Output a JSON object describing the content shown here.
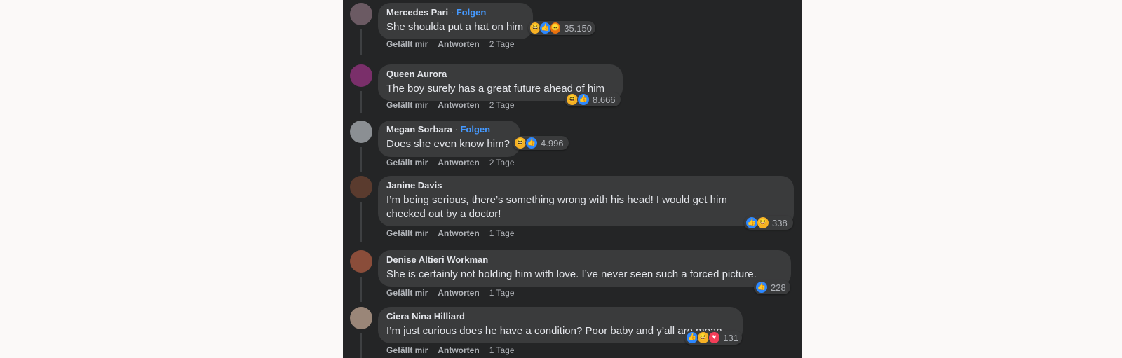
{
  "comments": [
    {
      "author": "Mercedes Pari",
      "follow": "Folgen",
      "text": "She shoulda put a hat on him",
      "like": "Gefällt mir",
      "reply": "Antworten",
      "time": "2 Tage",
      "reactions": [
        "haha",
        "like",
        "angry"
      ],
      "count": "35.150",
      "avatar_color": "#6b5a63"
    },
    {
      "author": "Queen Aurora",
      "follow": "",
      "text": "The boy surely has a great future ahead of him",
      "like": "Gefällt mir",
      "reply": "Antworten",
      "time": "2 Tage",
      "reactions": [
        "haha",
        "like"
      ],
      "count": "8.666",
      "avatar_color": "#7a2f6a"
    },
    {
      "author": "Megan Sorbara",
      "follow": "Folgen",
      "text": "Does she even know him?",
      "like": "Gefällt mir",
      "reply": "Antworten",
      "time": "2 Tage",
      "reactions": [
        "haha",
        "like"
      ],
      "count": "4.996",
      "avatar_color": "#8b8f93"
    },
    {
      "author": "Janine Davis",
      "follow": "",
      "text": "I’m being serious, there’s something wrong with his head! I would get him checked out by a doctor!",
      "like": "Gefällt mir",
      "reply": "Antworten",
      "time": "1 Tage",
      "reactions": [
        "like",
        "haha"
      ],
      "count": "338",
      "avatar_color": "#5a3b2e"
    },
    {
      "author": "Denise Altieri Workman",
      "follow": "",
      "text": "She is certainly not holding him with love. I’ve never seen such a forced picture.",
      "like": "Gefällt mir",
      "reply": "Antworten",
      "time": "1 Tage",
      "reactions": [
        "like"
      ],
      "count": "228",
      "avatar_color": "#8a4d3a"
    },
    {
      "author": "Ciera Nina Hilliard",
      "follow": "",
      "text": "I’m just curious does he have a condition? Poor baby and y’all are mean",
      "like": "Gefällt mir",
      "reply": "Antworten",
      "time": "1 Tage",
      "reactions": [
        "like",
        "haha",
        "love"
      ],
      "count": "131",
      "avatar_color": "#9a8678"
    }
  ],
  "colors": {
    "background": "#242526",
    "bubble": "#3a3b3c",
    "follow_link": "#4599ff",
    "like": "#2d88ff",
    "love": "#f33e58",
    "haha": "#f7b125",
    "angry": "#e9710f"
  }
}
